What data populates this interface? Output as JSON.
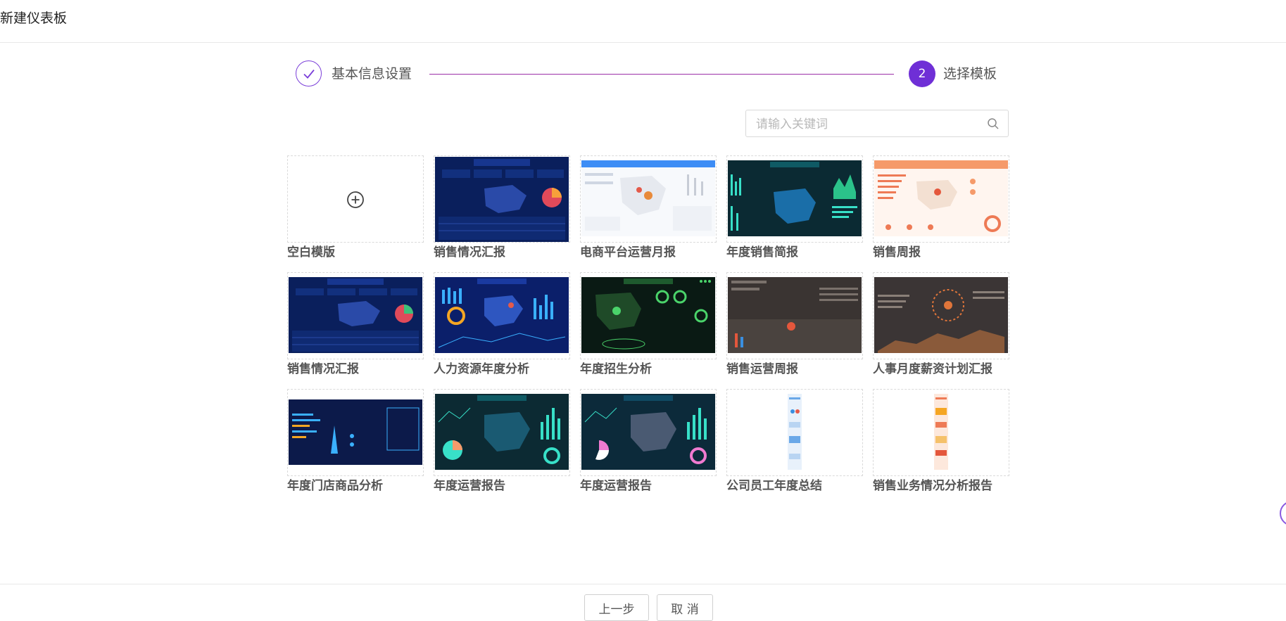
{
  "header": {
    "title": "新建仪表板"
  },
  "steps": [
    {
      "label": "基本信息设置",
      "status": "done",
      "icon": "check-icon"
    },
    {
      "number": "2",
      "label": "选择模板",
      "status": "active"
    }
  ],
  "search": {
    "placeholder": "请输入关键词",
    "value": "",
    "icon": "search-icon"
  },
  "templates": [
    {
      "name": "空白模版",
      "icon": "plus-circle-icon"
    },
    {
      "name": "销售情况汇报"
    },
    {
      "name": "电商平台运营月报"
    },
    {
      "name": "年度销售简报"
    },
    {
      "name": "销售周报"
    },
    {
      "name": "销售情况汇报"
    },
    {
      "name": "人力资源年度分析"
    },
    {
      "name": "年度招生分析"
    },
    {
      "name": "销售运营周报"
    },
    {
      "name": "人事月度薪资计划汇报"
    },
    {
      "name": "年度门店商品分析"
    },
    {
      "name": "年度运营报告"
    },
    {
      "name": "年度运营报告"
    },
    {
      "name": "公司员工年度总结"
    },
    {
      "name": "销售业务情况分析报告"
    }
  ],
  "footer": {
    "prev_label": "上一步",
    "cancel_label": "取 消"
  },
  "colors": {
    "accent": "#6f2fd6",
    "step_line": "#9b2fa8"
  }
}
